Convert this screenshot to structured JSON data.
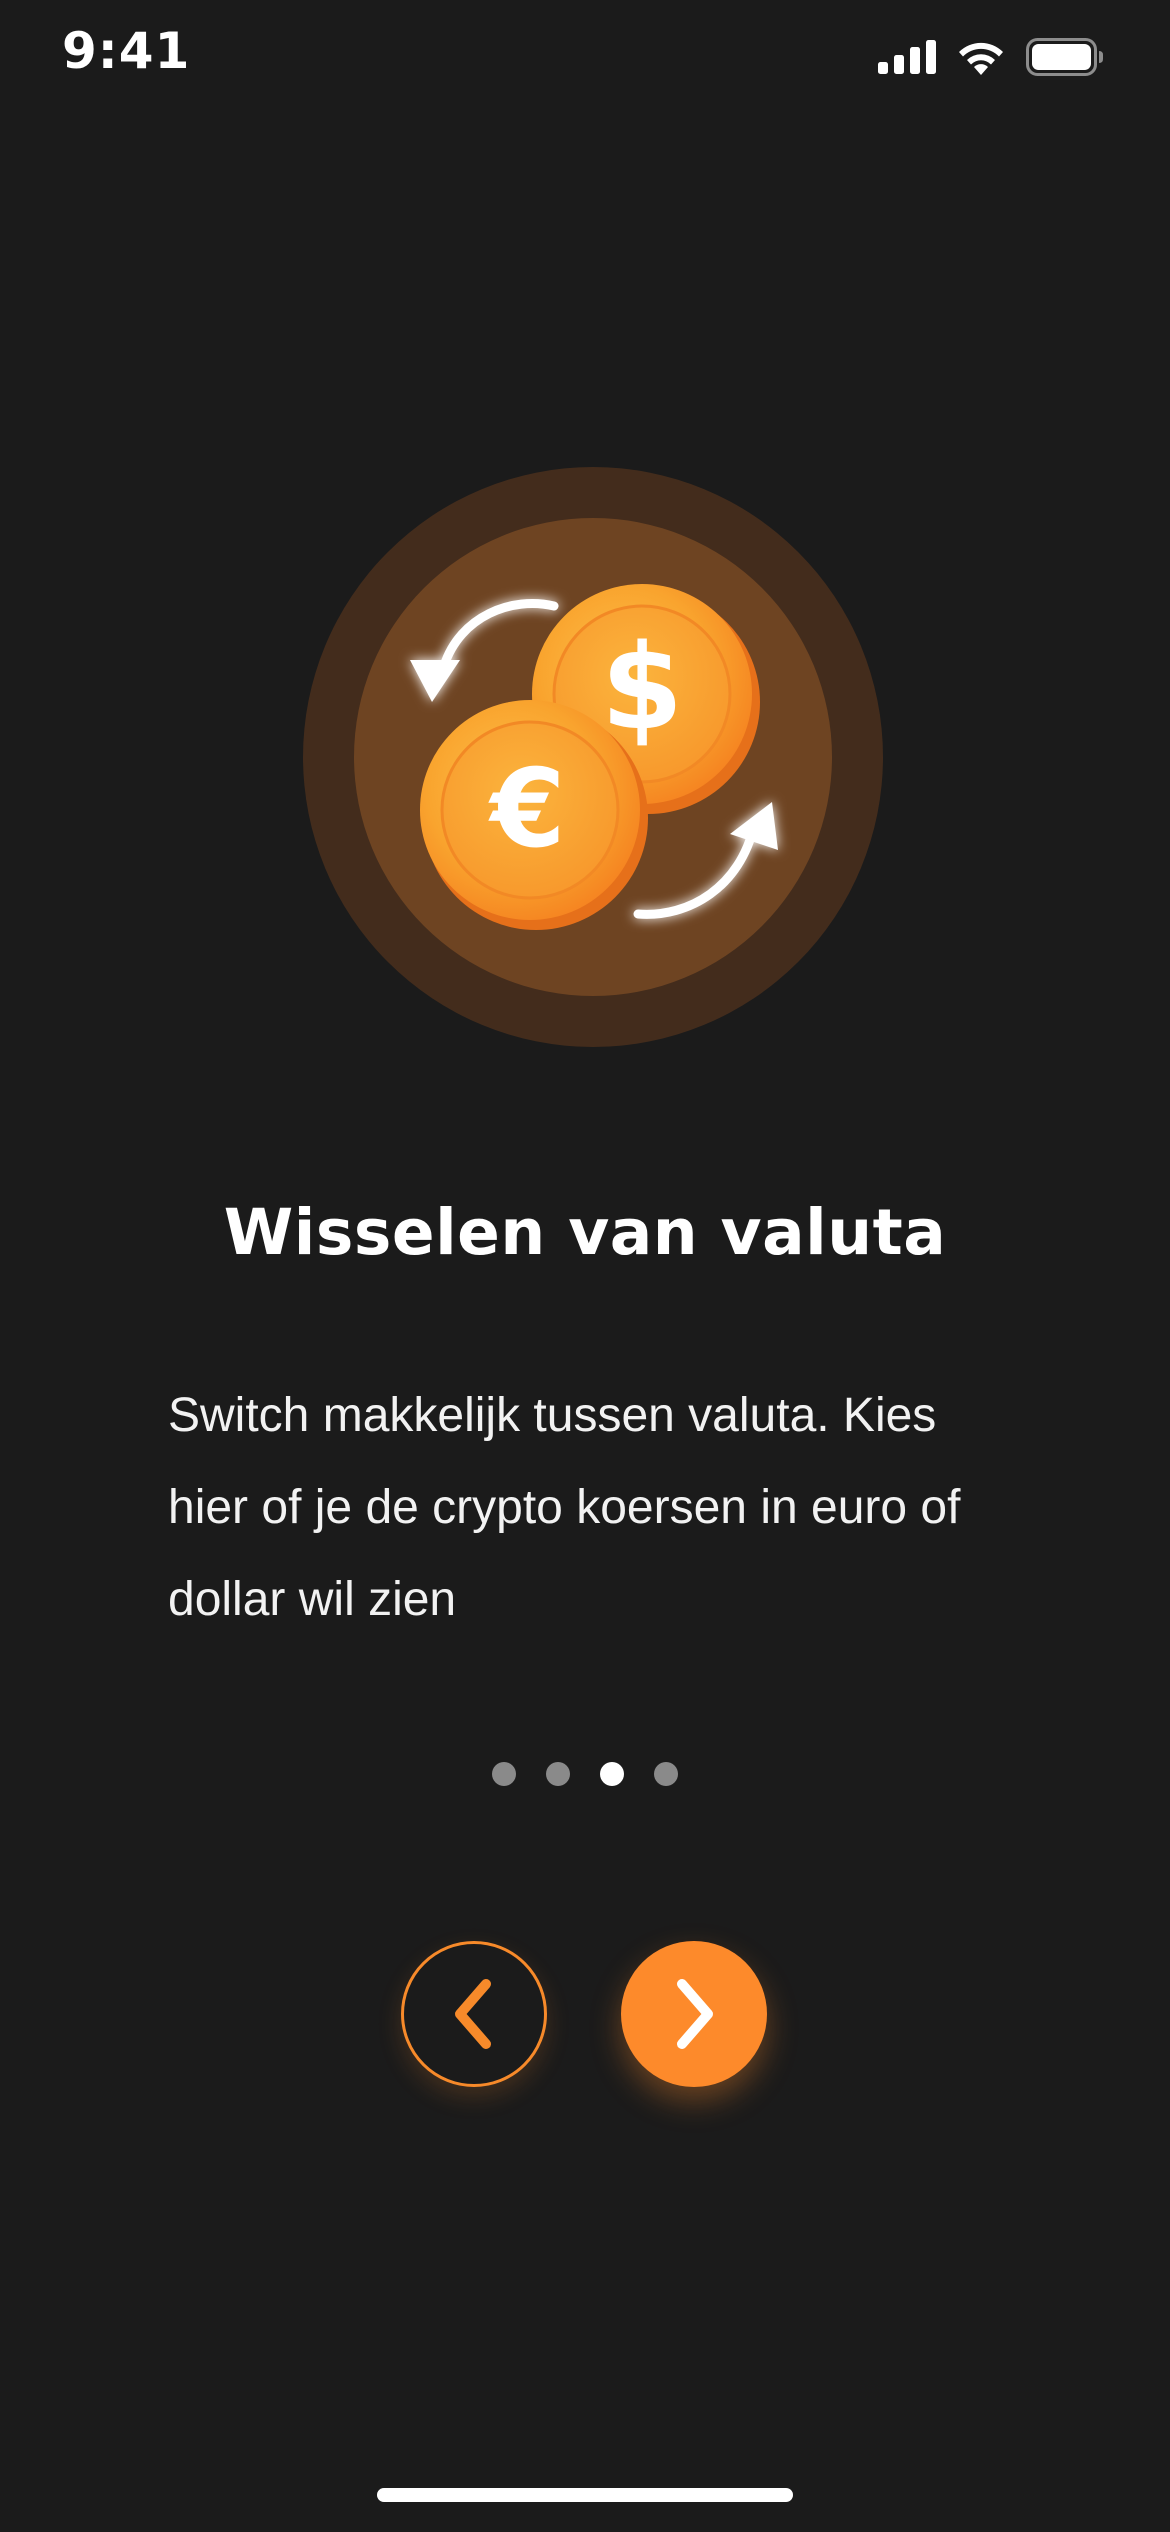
{
  "status_bar": {
    "time": "9:41"
  },
  "onboarding": {
    "title": "Wisselen van valuta",
    "description": "Switch makkelijk tussen valuta. Kies hier of je de crypto koersen in euro of dollar wil zien",
    "illustration": {
      "icons": [
        "euro-coin-icon",
        "dollar-coin-icon",
        "exchange-arrows-icon"
      ],
      "euro_symbol": "€",
      "dollar_symbol": "$"
    },
    "pagination": {
      "total": 4,
      "active_index": 2
    },
    "buttons": {
      "previous_icon": "chevron-left-icon",
      "next_icon": "chevron-right-icon"
    }
  },
  "colors": {
    "background": "#1b1b1b",
    "accent": "#fd8a2b",
    "dot_inactive": "#8a8a8a",
    "dot_active": "#ffffff",
    "text": "#ffffff"
  }
}
